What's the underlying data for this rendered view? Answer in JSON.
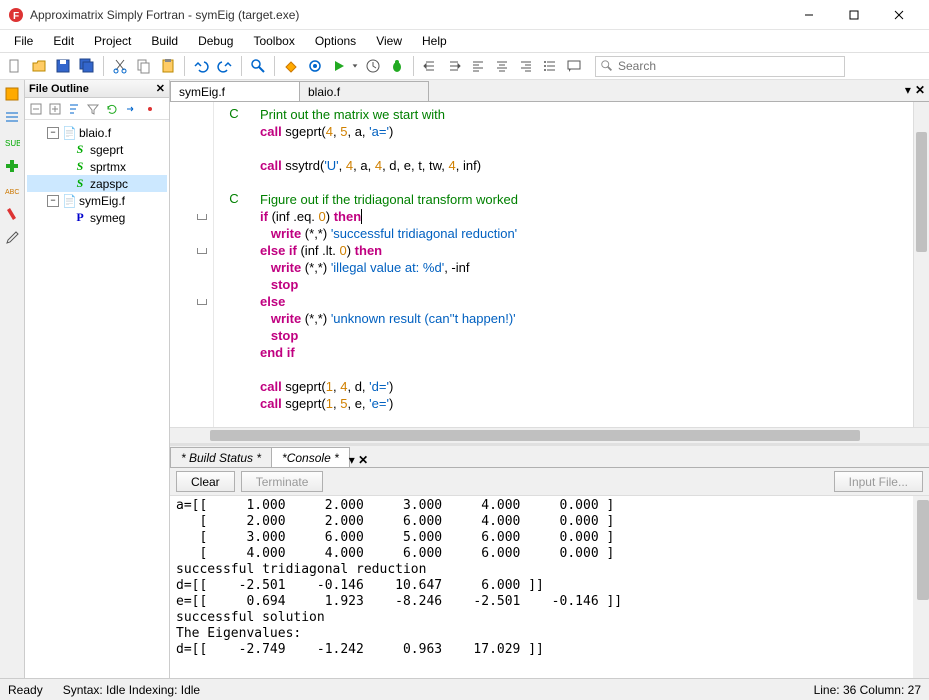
{
  "window": {
    "title": "Approximatrix Simply Fortran - symEig (target.exe)"
  },
  "menu": [
    "File",
    "Edit",
    "Project",
    "Build",
    "Debug",
    "Toolbox",
    "Options",
    "View",
    "Help"
  ],
  "search": {
    "placeholder": "Search"
  },
  "outline": {
    "title": "File Outline",
    "items": [
      {
        "label": "blaio.f",
        "type": "file",
        "expanded": true
      },
      {
        "label": "sgeprt",
        "type": "sub"
      },
      {
        "label": "sprtmx",
        "type": "sub"
      },
      {
        "label": "zapspc",
        "type": "sub",
        "selected": true
      },
      {
        "label": "symEig.f",
        "type": "file",
        "expanded": true
      },
      {
        "label": "symeg",
        "type": "prog"
      }
    ]
  },
  "editor": {
    "tabs": [
      {
        "label": "symEig.f",
        "active": true
      },
      {
        "label": "blaio.f",
        "active": false
      }
    ],
    "lines": [
      {
        "c": "C",
        "html": "<span class='cm'>Print out the matrix we start with</span>"
      },
      {
        "c": "",
        "html": "<span class='kw'>call</span> sgeprt(<span class='nm'>4</span>, <span class='nm'>5</span>, a, <span class='st'>'a='</span>)"
      },
      {
        "c": "",
        "html": ""
      },
      {
        "c": "",
        "html": "<span class='kw'>call</span> ssytrd(<span class='st'>'U'</span>, <span class='nm'>4</span>, a, <span class='nm'>4</span>, d, e, t, tw, <span class='nm'>4</span>, inf)"
      },
      {
        "c": "",
        "html": ""
      },
      {
        "c": "C",
        "html": "<span class='cm'>Figure out if the tridiagonal transform worked</span>"
      },
      {
        "c": "",
        "html": "<span class='kw'>if</span> (inf .eq. <span class='nm'>0</span>) <span class='kw'>then</span><span class='cursor-mark'></span>"
      },
      {
        "c": "",
        "html": "   <span class='kw'>write</span> (*,*) <span class='st'>'successful tridiagonal reduction'</span>"
      },
      {
        "c": "",
        "html": "<span class='kw'>else if</span> (inf .lt. <span class='nm'>0</span>) <span class='kw'>then</span>"
      },
      {
        "c": "",
        "html": "   <span class='kw'>write</span> (*,*) <span class='st'>'illegal value at: %d'</span>, -inf"
      },
      {
        "c": "",
        "html": "   <span class='kw'>stop</span>"
      },
      {
        "c": "",
        "html": "<span class='kw'>else</span>"
      },
      {
        "c": "",
        "html": "   <span class='kw'>write</span> (*,*) <span class='st'>'unknown result (can''t happen!)'</span>"
      },
      {
        "c": "",
        "html": "   <span class='kw'>stop</span>"
      },
      {
        "c": "",
        "html": "<span class='kw'>end if</span>"
      },
      {
        "c": "",
        "html": ""
      },
      {
        "c": "",
        "html": "<span class='kw'>call</span> sgeprt(<span class='nm'>1</span>, <span class='nm'>4</span>, d, <span class='st'>'d='</span>)"
      },
      {
        "c": "",
        "html": "<span class='kw'>call</span> sgeprt(<span class='nm'>1</span>, <span class='nm'>5</span>, e, <span class='st'>'e='</span>)"
      }
    ]
  },
  "bottom": {
    "tabs": [
      {
        "label": "* Build Status *",
        "active": false
      },
      {
        "label": "*Console *",
        "active": true
      }
    ],
    "buttons": {
      "clear": "Clear",
      "terminate": "Terminate",
      "input": "Input File..."
    },
    "output": "a=[[     1.000     2.000     3.000     4.000     0.000 ]\n   [     2.000     2.000     6.000     4.000     0.000 ]\n   [     3.000     6.000     5.000     6.000     0.000 ]\n   [     4.000     4.000     6.000     6.000     0.000 ]\nsuccessful tridiagonal reduction\nd=[[    -2.501    -0.146    10.647     6.000 ]]\ne=[[     0.694     1.923    -8.246    -2.501    -0.146 ]]\nsuccessful solution\nThe Eigenvalues:\nd=[[    -2.749    -1.242     0.963    17.029 ]]"
  },
  "status": {
    "ready": "Ready",
    "syntax": "Syntax: Idle  Indexing: Idle",
    "pos": "Line: 36 Column: 27"
  }
}
